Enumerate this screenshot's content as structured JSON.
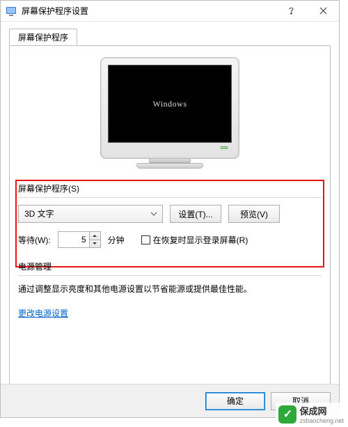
{
  "titlebar": {
    "title": "屏幕保护程序设置"
  },
  "tab": {
    "label": "屏幕保护程序"
  },
  "preview": {
    "screen_text": "Windows"
  },
  "screensaver_group": {
    "title": "屏幕保护程序(S)",
    "selected": "3D 文字",
    "settings_btn": "设置(T)...",
    "preview_btn": "预览(V)",
    "wait_label": "等待(W):",
    "wait_value": "5",
    "wait_unit": "分钟",
    "resume_chk": "在恢复时显示登录屏幕(R)"
  },
  "power_group": {
    "title": "电源管理",
    "desc": "通过调整显示亮度和其他电源设置以节省能源或提供最佳性能。",
    "link": "更改电源设置"
  },
  "buttons": {
    "ok": "确定",
    "cancel": "取消"
  },
  "watermark": {
    "name": "保成网",
    "url": "zsbaocheng.net"
  }
}
